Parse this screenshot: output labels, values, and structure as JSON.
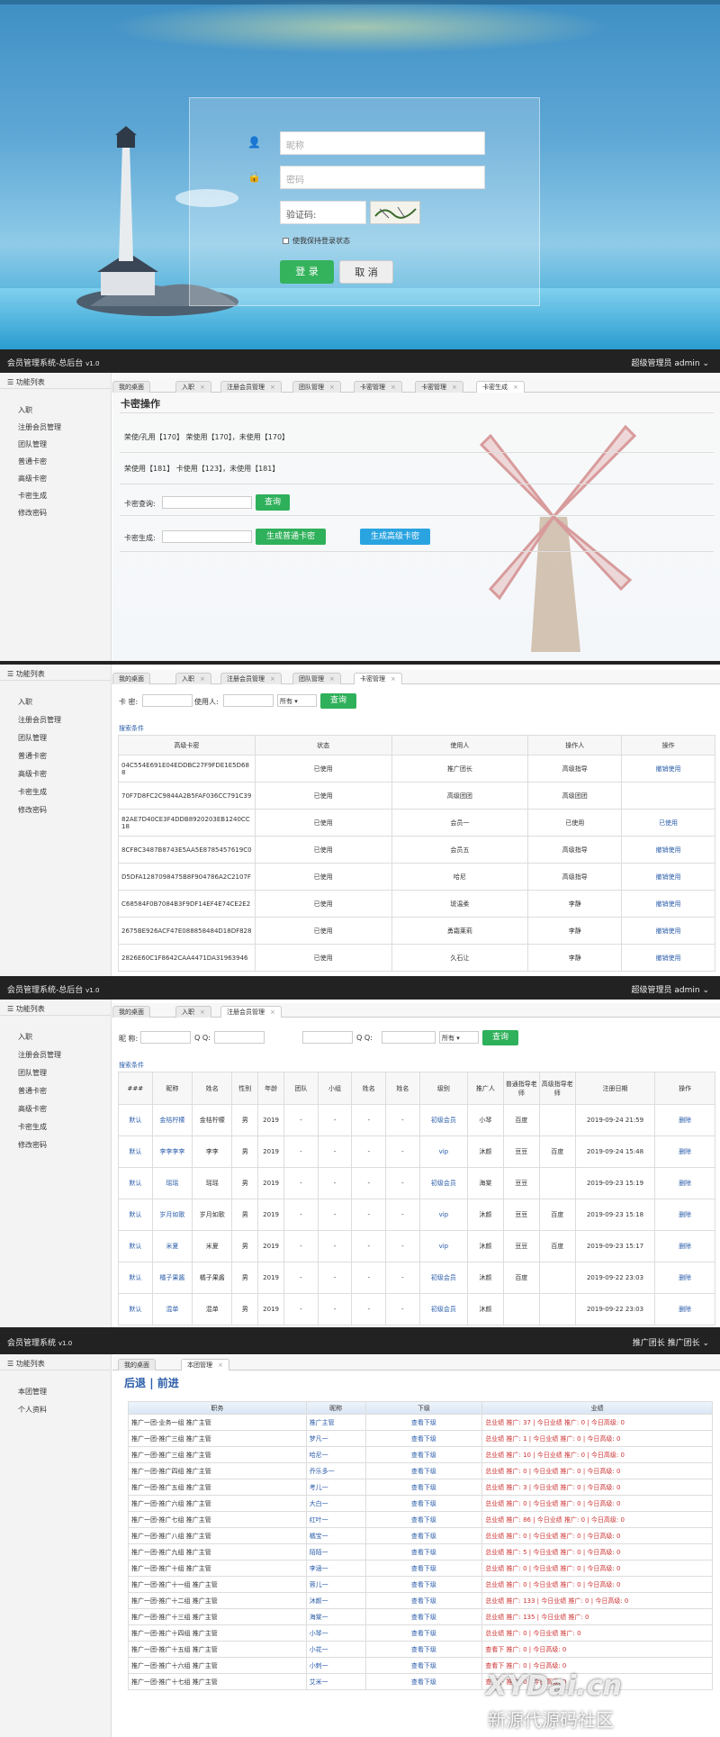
{
  "login": {
    "nickname_placeholder": "昵称",
    "password_placeholder": "密码",
    "captcha_label": "验证码:",
    "remember_label": "使我保持登录状态",
    "login_button": "登 录",
    "cancel_button": "取 消"
  },
  "app_title": "会员管理系统-总后台",
  "app_version": "v1.0",
  "user_role": "超级管理员",
  "user_name": "admin",
  "sidebar": {
    "header": "功能列表",
    "items": [
      "入职",
      "注册会员管理",
      "团队管理",
      "普通卡密",
      "高级卡密",
      "卡密生成",
      "修改密码"
    ]
  },
  "screen2": {
    "tabs": [
      "我的桌面",
      "入职",
      "注册会员管理",
      "团队管理",
      "卡密管理",
      "卡密管理",
      "卡密生成"
    ],
    "title": "卡密操作",
    "stats_line1": "荣使/孔用【170】  荣使用【170】，未使用【170】",
    "stats_line2": "荣使用【181】         卡使用【123】，未使用【181】",
    "query_label": "卡密查询:",
    "query_button": "查询",
    "generate_label": "卡密生成:",
    "gen_normal_button": "生成普通卡密",
    "gen_advanced_button": "生成高级卡密"
  },
  "screen3": {
    "tabs": [
      "我的桌面",
      "入职",
      "注册会员管理",
      "团队管理",
      "卡密管理"
    ],
    "kami_label": "卡 密:",
    "user_label": "使用人:",
    "select_value": "所有",
    "query_button": "查询",
    "search_conditions": "搜索条件",
    "headers": [
      "高级卡密",
      "状态",
      "使用人",
      "操作人",
      "操作"
    ],
    "rows": [
      [
        "04C554E691E04EDDBC27F9FDE1E5D688",
        "已使用",
        "推广团长",
        "高级指导",
        "撤销使用"
      ],
      [
        "70F7D8FC2C9844A2B5FAF036CC791C39",
        "已使用",
        "高级团团",
        "高级团团",
        ""
      ],
      [
        "82AE7D40CE3F4DDB8920203EB1240CC18",
        "已使用",
        "会员一",
        "已使用",
        "已使用"
      ],
      [
        "8CF8C3487B8743E5AA5E8785457619C0",
        "已使用",
        "会员五",
        "高级指导",
        "撤销使用"
      ],
      [
        "D5DFA1287098475B8F904786A2C2107F",
        "已使用",
        "哈尼",
        "高级指导",
        "撤销使用"
      ],
      [
        "C68584F0B7084B3F9DF14EF4E74CE2E2",
        "已使用",
        "琥温柔",
        "李静",
        "撤销使用"
      ],
      [
        "2675BE926ACF47E088858484D18DF828",
        "已使用",
        "勇霜莱莉",
        "李静",
        "撤销使用"
      ],
      [
        "2826E60C1F8642CAA4471DA31963946",
        "已使用",
        "久石让",
        "李静",
        "撤销使用"
      ]
    ]
  },
  "screen4": {
    "tabs": [
      "我的桌面",
      "入职",
      "注册会员管理"
    ],
    "nick_label": "昵 称:",
    "qq_label": "Q Q:",
    "qq_label2": "Q Q:",
    "select_value": "所有",
    "query_button": "查询",
    "search_conditions": "搜索条件",
    "headers": [
      "###",
      "昵称",
      "姓名",
      "性别",
      "年龄",
      "团队",
      "小组",
      "姓名",
      "姓名",
      "级别",
      "推广人",
      "普通指导老师",
      "高级指导老师",
      "注册日期",
      "操作"
    ],
    "rows": [
      [
        "默认",
        "金桔柠檬",
        "金桔柠檬",
        "男",
        "2019",
        "-",
        "-",
        "-",
        "-",
        "初级会员",
        "小琴",
        "百度",
        "",
        "2019-09-24 21:59",
        "删除"
      ],
      [
        "默认",
        "李李李李",
        "李李",
        "男",
        "2019",
        "-",
        "-",
        "-",
        "-",
        "vip",
        "沐颜",
        "豆豆",
        "百度",
        "2019-09-24 15:48",
        "删除"
      ],
      [
        "默认",
        "瑶瑶",
        "瑶瑶",
        "男",
        "2019",
        "-",
        "-",
        "-",
        "-",
        "初级会员",
        "海棠",
        "豆豆",
        "",
        "2019-09-23 15:19",
        "删除"
      ],
      [
        "默认",
        "岁月如歌",
        "岁月如歌",
        "男",
        "2019",
        "-",
        "-",
        "-",
        "-",
        "vip",
        "沐颜",
        "豆豆",
        "百度",
        "2019-09-23 15:18",
        "删除"
      ],
      [
        "默认",
        "米夏",
        "米夏",
        "男",
        "2019",
        "-",
        "-",
        "-",
        "-",
        "vip",
        "沐颜",
        "豆豆",
        "百度",
        "2019-09-23 15:17",
        "删除"
      ],
      [
        "默认",
        "橘子果酱",
        "橘子果酱",
        "男",
        "2019",
        "-",
        "-",
        "-",
        "-",
        "初级会员",
        "沐颜",
        "百度",
        "",
        "2019-09-22 23:03",
        "删除"
      ],
      [
        "默认",
        "混单",
        "混单",
        "男",
        "2019",
        "-",
        "-",
        "-",
        "-",
        "初级会员",
        "沐颜",
        "",
        "",
        "2019-09-22 23:03",
        "删除"
      ]
    ]
  },
  "screen5": {
    "app_title": "会员管理系统",
    "user_role": "推广团长",
    "user_name": "推广团长",
    "sidebar_items": [
      "本团管理",
      "个人资料"
    ],
    "tabs": [
      "我的桌面",
      "本团管理"
    ],
    "back": "后退",
    "forward": "前进",
    "headers": [
      "职务",
      "昵称",
      "下级",
      "业绩"
    ],
    "rows": [
      [
        "推广一团-业务一组 推广主管",
        "推广主管",
        "查看下级",
        "总业绩 推广: 37 | 今日业绩 推广: 0 | 今日高级: 0"
      ],
      [
        "推广一团-推广三组 推广主管",
        "梦凡一",
        "查看下级",
        "总业绩 推广: 1 | 今日业绩 推广: 0 | 今日高级: 0"
      ],
      [
        "推广一团-推广三组 推广主管",
        "哈尼一",
        "查看下级",
        "总业绩 推广: 10 | 今日业绩 推广: 0 | 今日高级: 0"
      ],
      [
        "推广一团-推广四组 推广主管",
        "乔乐多一",
        "查看下级",
        "总业绩 推广: 0 | 今日业绩 推广: 0 | 今日高级: 0"
      ],
      [
        "推广一团-推广五组 推广主管",
        "考儿一",
        "查看下级",
        "总业绩 推广: 3 | 今日业绩 推广: 0 | 今日高级: 0"
      ],
      [
        "推广一团-推广六组 推广主管",
        "大白一",
        "查看下级",
        "总业绩 推广: 0 | 今日业绩 推广: 0 | 今日高级: 0"
      ],
      [
        "推广一团-推广七组 推广主管",
        "红叶一",
        "查看下级",
        "总业绩 推广: 86 | 今日业绩 推广: 0 | 今日高级: 0"
      ],
      [
        "推广一团-推广八组 推广主管",
        "橘宝一",
        "查看下级",
        "总业绩 推广: 0 | 今日业绩 推广: 0 | 今日高级: 0"
      ],
      [
        "推广一团-推广九组 推广主管",
        "陌陌一",
        "查看下级",
        "总业绩 推广: 5 | 今日业绩 推广: 0 | 今日高级: 0"
      ],
      [
        "推广一团-推广十组 推广主管",
        "李涵一",
        "查看下级",
        "总业绩 推广: 0 | 今日业绩 推广: 0 | 今日高级: 0"
      ],
      [
        "推广一团-推广十一组 推广主管",
        "蓉儿一",
        "查看下级",
        "总业绩 推广: 0 | 今日业绩 推广: 0 | 今日高级: 0"
      ],
      [
        "推广一团-推广十二组 推广主管",
        "沐颜一",
        "查看下级",
        "总业绩 推广: 133 | 今日业绩 推广: 0 | 今日高级: 0"
      ],
      [
        "推广一团-推广十三组 推广主管",
        "海棠一",
        "查看下级",
        "总业绩 推广: 135 | 今日业绩 推广: 0"
      ],
      [
        "推广一团-推广十四组 推广主管",
        "小琴一",
        "查看下级",
        "总业绩 推广: 0 | 今日业绩 推广: 0"
      ],
      [
        "推广一团-推广十五组 推广主管",
        "小花一",
        "查看下级",
        "查看下 推广: 0 | 今日高级: 0"
      ],
      [
        "推广一团-推广十六组 推广主管",
        "小刺一",
        "查看下级",
        "查看下 推广: 0 | 今日高级: 0"
      ],
      [
        "推广一团-推广十七组 推广主管",
        "艾米一",
        "查看下级",
        "查看下 推广: 0 | 今日高级: 0"
      ]
    ]
  },
  "watermark_text": "XYDai.cn",
  "watermark_sub": "新源代源码社区",
  "colors": {
    "green": "#2fb05a",
    "blue": "#2aa4e0",
    "topbar": "#222222",
    "link": "#2a5caa",
    "red": "#cc3333"
  }
}
